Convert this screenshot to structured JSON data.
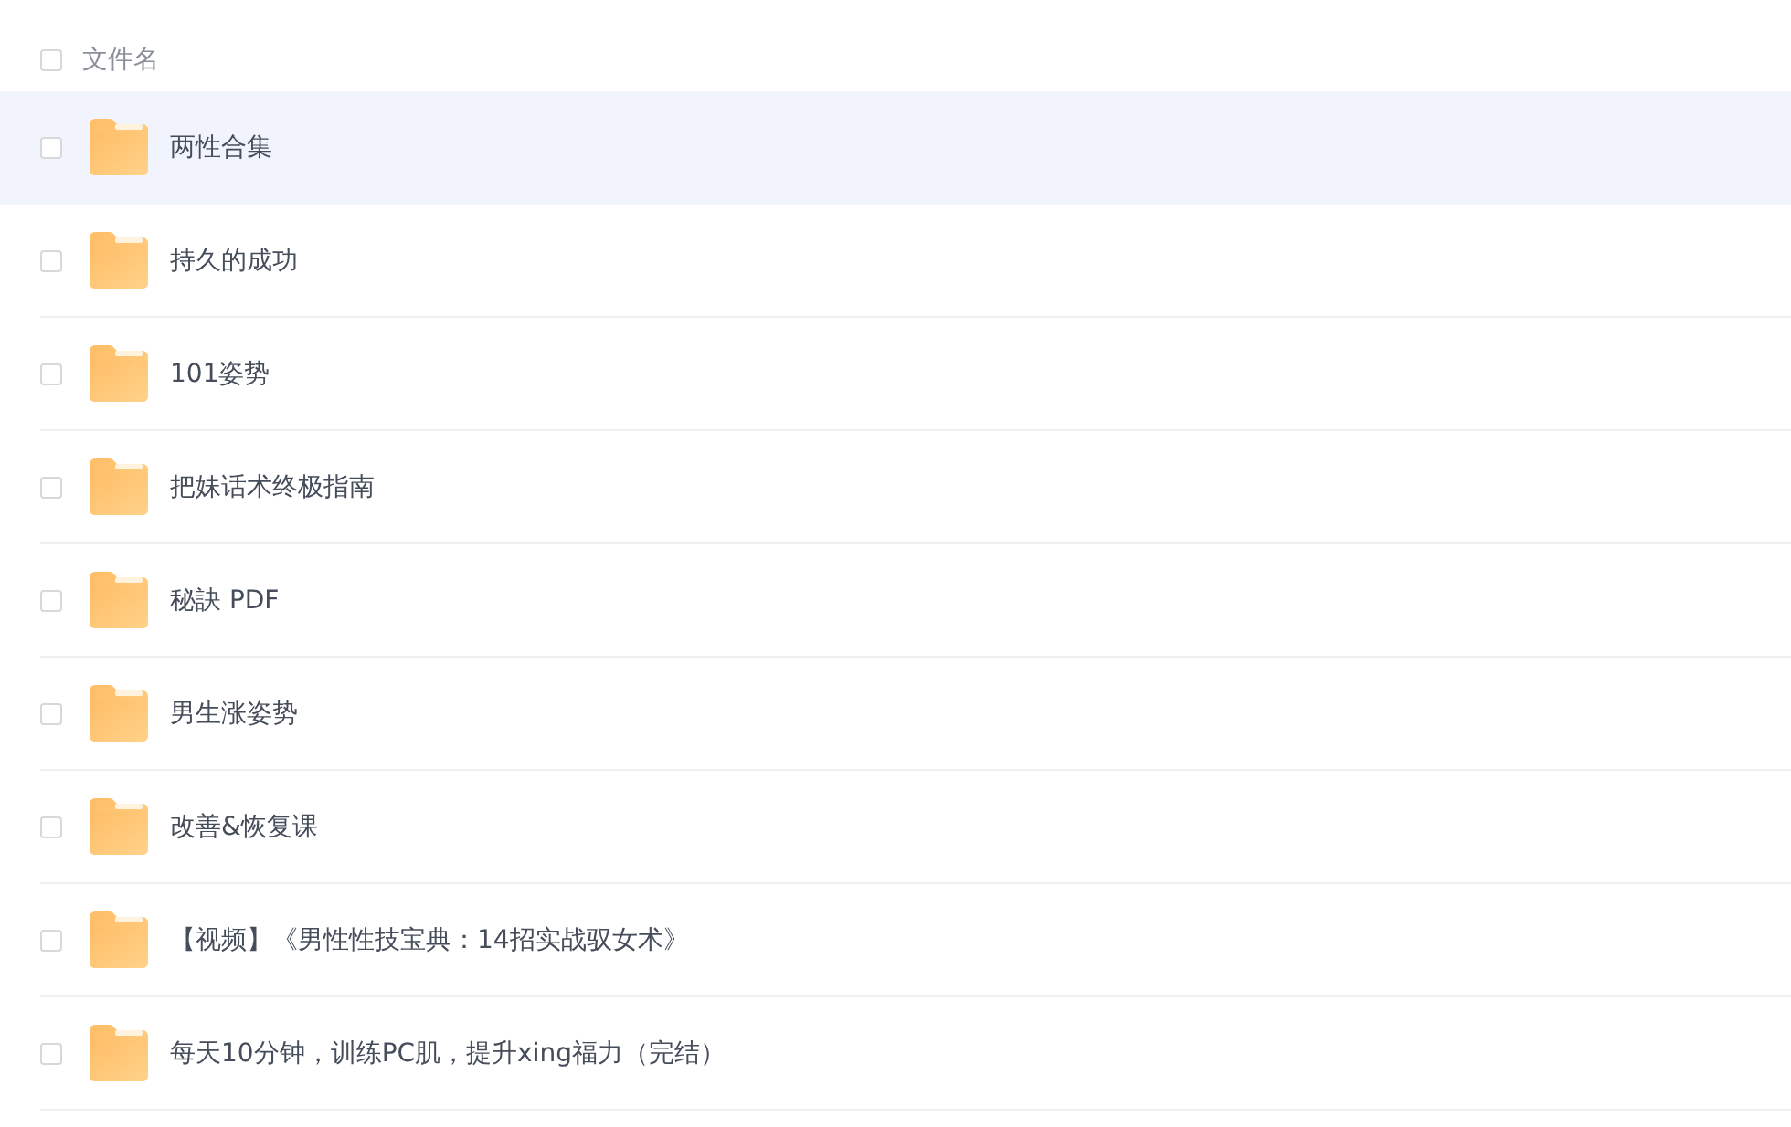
{
  "header": {
    "checked": false,
    "label": "文件名"
  },
  "files": [
    {
      "name": "两性合集",
      "checked": false,
      "selected": true
    },
    {
      "name": "持久的成功",
      "checked": false,
      "selected": false
    },
    {
      "name": "101姿势",
      "checked": false,
      "selected": false
    },
    {
      "name": "把妹话术终极指南",
      "checked": false,
      "selected": false
    },
    {
      "name": "秘訣 PDF",
      "checked": false,
      "selected": false
    },
    {
      "name": "男生涨姿势",
      "checked": false,
      "selected": false
    },
    {
      "name": "改善&恢复课",
      "checked": false,
      "selected": false
    },
    {
      "name": "【视频】《男性性技宝典：14招实战驭女术》",
      "checked": false,
      "selected": false
    },
    {
      "name": "每天10分钟，训练PC肌，提升xing福力（完结）",
      "checked": false,
      "selected": false
    }
  ]
}
